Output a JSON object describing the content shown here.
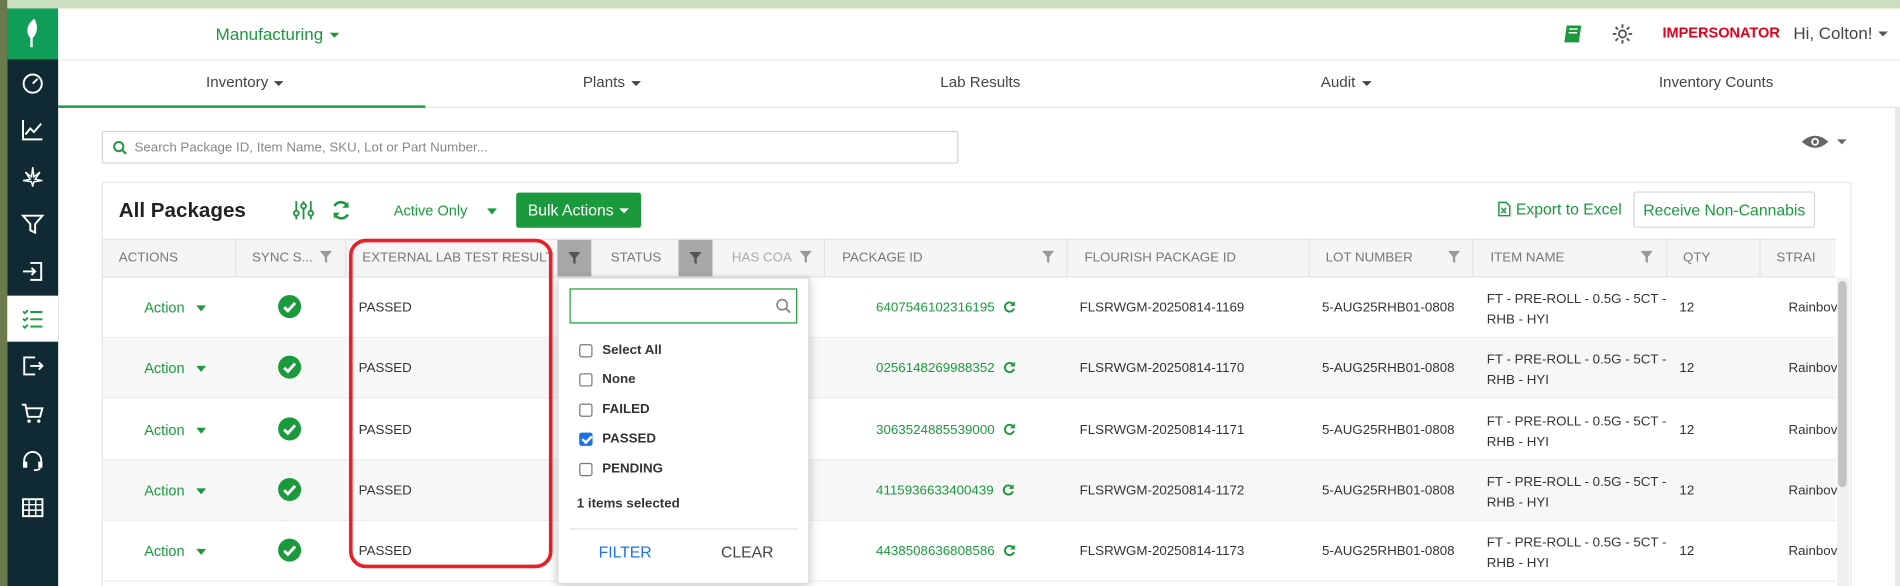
{
  "header": {
    "workspace": "Manufacturing",
    "impersonator": "IMPERSONATOR",
    "greeting": "Hi, Colton!"
  },
  "nav": {
    "tabs": [
      {
        "label": "Inventory",
        "dropdown": true,
        "active": true
      },
      {
        "label": "Plants",
        "dropdown": true
      },
      {
        "label": "Lab Results",
        "dropdown": false
      },
      {
        "label": "Audit",
        "dropdown": true
      },
      {
        "label": "Inventory Counts",
        "dropdown": false
      }
    ]
  },
  "search": {
    "placeholder": "Search Package ID, Item Name, SKU, Lot or Part Number..."
  },
  "toolbar": {
    "title": "All Packages",
    "filter_select": "Active Only",
    "bulk_actions": "Bulk Actions",
    "export": "Export to Excel",
    "receive": "Receive Non-Cannabis"
  },
  "columns": {
    "actions": "ACTIONS",
    "sync": "SYNC S...",
    "external_lab": "EXTERNAL LAB TEST RESULT",
    "status": "STATUS",
    "has_coa": "HAS COA",
    "package_id": "PACKAGE ID",
    "flourish_id": "FLOURISH PACKAGE ID",
    "lot": "LOT NUMBER",
    "item": "ITEM NAME",
    "qty": "QTY",
    "strain": "STRAI"
  },
  "rows": [
    {
      "action": "Action",
      "lab": "PASSED",
      "package_id": "6407546102316195",
      "flourish_id": "FLSRWGM-20250814-1169",
      "lot": "5-AUG25RHB01-0808",
      "item_line1": "FT - PRE-ROLL - 0.5G - 5CT -",
      "item_line2": "RHB - HYI",
      "qty": "12",
      "strain": "Rainbov"
    },
    {
      "action": "Action",
      "lab": "PASSED",
      "package_id": "0256148269988352",
      "flourish_id": "FLSRWGM-20250814-1170",
      "lot": "5-AUG25RHB01-0808",
      "item_line1": "FT - PRE-ROLL - 0.5G - 5CT -",
      "item_line2": "RHB - HYI",
      "qty": "12",
      "strain": "Rainbov"
    },
    {
      "action": "Action",
      "lab": "PASSED",
      "package_id": "3063524885539000",
      "flourish_id": "FLSRWGM-20250814-1171",
      "lot": "5-AUG25RHB01-0808",
      "item_line1": "FT - PRE-ROLL - 0.5G - 5CT -",
      "item_line2": "RHB - HYI",
      "qty": "12",
      "strain": "Rainbov"
    },
    {
      "action": "Action",
      "lab": "PASSED",
      "package_id": "4115936633400439",
      "flourish_id": "FLSRWGM-20250814-1172",
      "lot": "5-AUG25RHB01-0808",
      "item_line1": "FT - PRE-ROLL - 0.5G - 5CT -",
      "item_line2": "RHB - HYI",
      "qty": "12",
      "strain": "Rainbov"
    },
    {
      "action": "Action",
      "lab": "PASSED",
      "package_id": "4438508636808586",
      "flourish_id": "FLSRWGM-20250814-1173",
      "lot": "5-AUG25RHB01-0808",
      "item_line1": "FT - PRE-ROLL - 0.5G - 5CT -",
      "item_line2": "RHB - HYI",
      "qty": "12",
      "strain": "Rainbov"
    }
  ],
  "status_filter": {
    "search_value": "",
    "options": [
      {
        "label": "Select All",
        "checked": false
      },
      {
        "label": "None",
        "checked": false
      },
      {
        "label": "FAILED",
        "checked": false
      },
      {
        "label": "PASSED",
        "checked": true
      },
      {
        "label": "PENDING",
        "checked": false
      }
    ],
    "selected_count": "1 items selected",
    "filter_label": "FILTER",
    "clear_label": "CLEAR"
  },
  "colors": {
    "brand_green": "#1a9a3c",
    "sidebar": "#0f2a33",
    "highlight": "#e8202a",
    "link_blue": "#1a73e8"
  }
}
